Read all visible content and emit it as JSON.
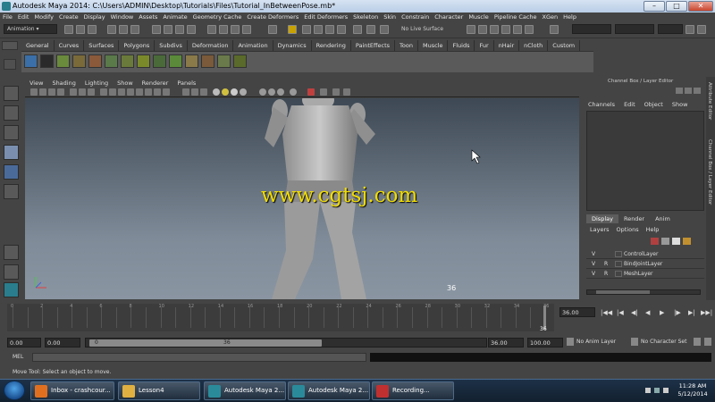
{
  "window": {
    "title": "Autodesk Maya 2014: C:\\Users\\ADMIN\\Desktop\\Tutorials\\Files\\Tutorial_InBetweenPose.mb*"
  },
  "menus": [
    "File",
    "Edit",
    "Modify",
    "Create",
    "Display",
    "Window",
    "Assets",
    "Animate",
    "Geometry Cache",
    "Create Deformers",
    "Edit Deformers",
    "Skeleton",
    "Skin",
    "Constrain",
    "Character",
    "Muscle",
    "Pipeline Cache",
    "XGen",
    "Help"
  ],
  "status": {
    "mode": "Animation",
    "live_surface": "No Live Surface"
  },
  "shelf_tabs": [
    "General",
    "Curves",
    "Surfaces",
    "Polygons",
    "Subdivs",
    "Deformation",
    "Animation",
    "Dynamics",
    "Rendering",
    "PaintEffects",
    "Toon",
    "Muscle",
    "Fluids",
    "Fur",
    "nHair",
    "nCloth",
    "Custom",
    "XGen"
  ],
  "shelf_active": "XGen",
  "panel_menu": [
    "View",
    "Shading",
    "Lighting",
    "Show",
    "Renderer",
    "Panels"
  ],
  "viewport": {
    "watermark": "www.cgtsj.com",
    "frame": "36"
  },
  "channel_box": {
    "title": "Channel Box / Layer Editor",
    "menu": [
      "Channels",
      "Edit",
      "Object",
      "Show"
    ]
  },
  "layer_editor": {
    "tabs": [
      "Display",
      "Render",
      "Anim"
    ],
    "menu": [
      "Layers",
      "Options",
      "Help"
    ],
    "layers": [
      {
        "v": "V",
        "r": "",
        "name": "ControlLayer"
      },
      {
        "v": "V",
        "r": "R",
        "name": "BindJointLayer"
      },
      {
        "v": "V",
        "r": "R",
        "name": "MeshLayer"
      }
    ]
  },
  "side_tabs": [
    "Attribute Editor",
    "Channel Box / Layer Editor"
  ],
  "timeline": {
    "ticks": [
      "0",
      "2",
      "4",
      "6",
      "8",
      "10",
      "12",
      "14",
      "16",
      "18",
      "20",
      "22",
      "24",
      "26",
      "28",
      "30",
      "32",
      "34",
      "36"
    ],
    "current_frame": "36",
    "current_field": "36.00"
  },
  "range": {
    "start": "0.00",
    "anim_start": "0.00",
    "slider_start": "0",
    "slider_end": "36",
    "end": "36.00",
    "anim_end": "100.00",
    "anim_layer": "No Anim Layer",
    "character_set": "No Character Set"
  },
  "mel_label": "MEL",
  "help_line": "Move Tool: Select an object to move.",
  "taskbar": {
    "items": [
      {
        "label": "Inbox - crashcour...",
        "color": "#e07020"
      },
      {
        "label": "Lesson4",
        "color": "#e0b040"
      },
      {
        "label": "Autodesk Maya 2...",
        "color": "#2a8a9a"
      },
      {
        "label": "Autodesk Maya 2...",
        "color": "#2a8a9a"
      },
      {
        "label": "Recording...",
        "color": "#c03030"
      }
    ],
    "time": "11:28 AM",
    "date": "5/12/2014"
  }
}
